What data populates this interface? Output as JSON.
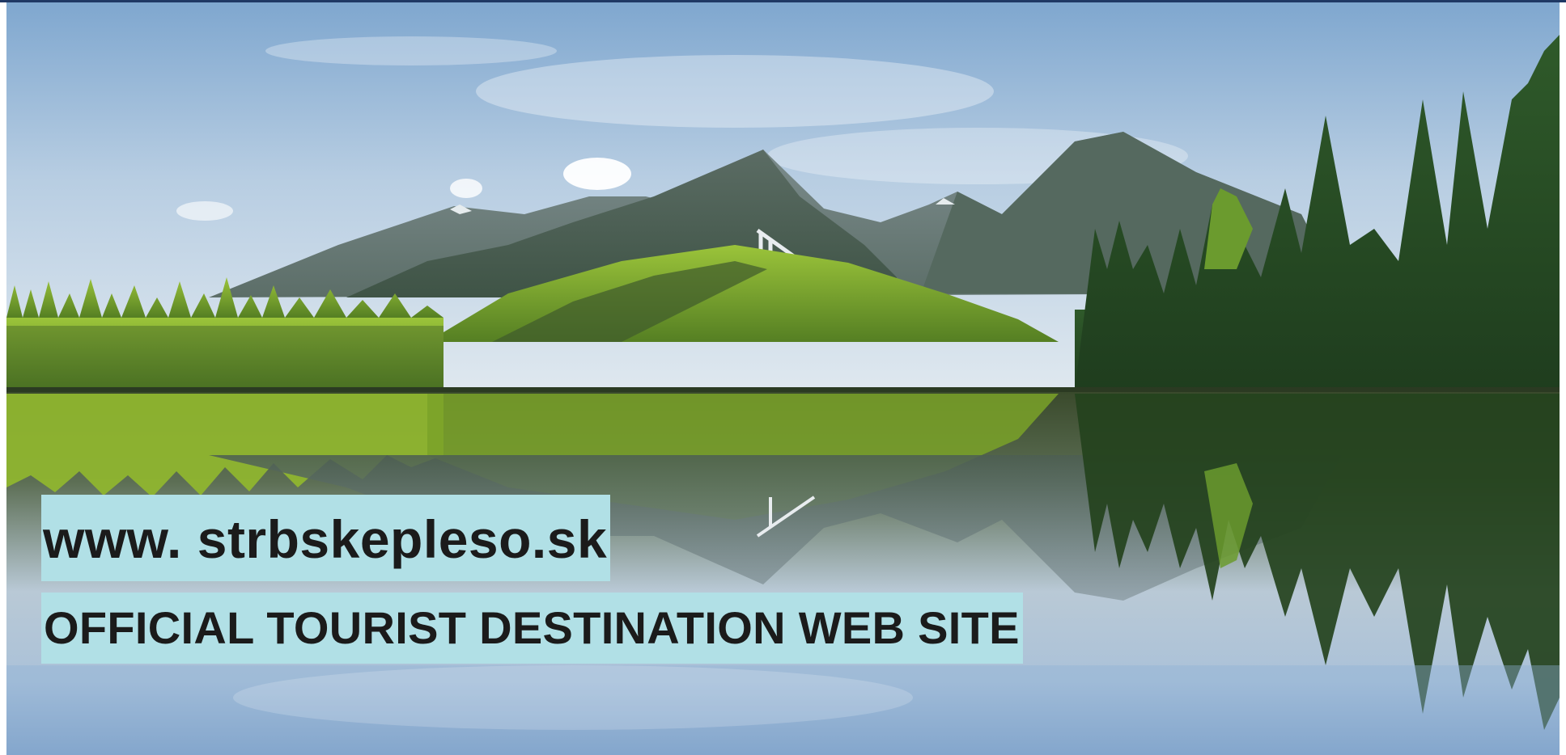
{
  "banner": {
    "website": "www. strbskepleso.sk",
    "tagline": "OFFICIAL TOURIST DESTINATION WEB SITE"
  },
  "colors": {
    "caption_background": "#b1e0e6",
    "caption_text": "#1b1b1b",
    "top_rule": "#1f3864"
  },
  "scene": {
    "elements": [
      "sky-with-clouds",
      "mountain-range",
      "ski-jump-tower",
      "conifer-forest",
      "lake-reflection"
    ]
  }
}
